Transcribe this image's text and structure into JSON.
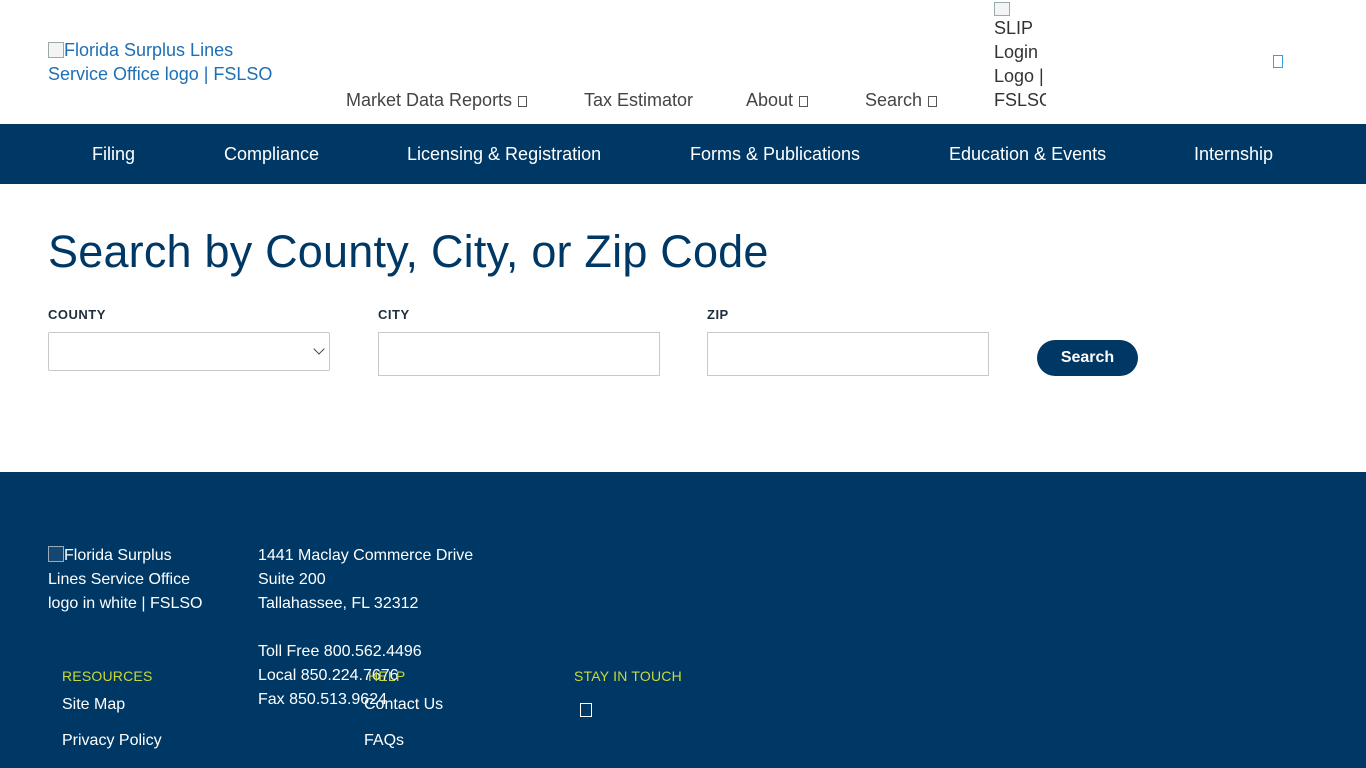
{
  "header": {
    "logo_alt": "Florida Surplus Lines Service Office logo | FSLSO",
    "nav": [
      {
        "label": "Market Data Reports",
        "has_dropdown": true
      },
      {
        "label": "Tax Estimator",
        "has_dropdown": false
      },
      {
        "label": "About",
        "has_dropdown": true
      },
      {
        "label": "Search",
        "has_dropdown": true
      }
    ],
    "slip_logo_alt": "SLIP Login Logo | FSLSO",
    "menu_icon": "menu-icon"
  },
  "main_nav": [
    "Filing",
    "Compliance",
    "Licensing & Registration",
    "Forms & Publications",
    "Education & Events",
    "Internship"
  ],
  "content": {
    "title": "Search by County, City, or Zip Code",
    "county_label": "COUNTY",
    "county_value": "",
    "city_label": "CITY",
    "city_value": "",
    "zip_label": "ZIP",
    "zip_value": "",
    "search_button": "Search"
  },
  "footer": {
    "logo_alt": "Florida Surplus Lines Service Office logo in white | FSLSO",
    "address": {
      "line1": "1441 Maclay Commerce Drive",
      "line2": "Suite 200",
      "line3": "Tallahassee, FL 32312",
      "toll_free": "Toll Free 800.562.4496",
      "local": "Local 850.224.7676",
      "fax": "Fax 850.513.9624"
    },
    "resources_heading": "RESOURCES",
    "resources_links": [
      "Site Map",
      "Privacy Policy"
    ],
    "help_heading": "HELP",
    "help_links": [
      "Contact Us",
      "FAQs"
    ],
    "stay_heading": "STAY IN TOUCH",
    "social_icon": "social-icon"
  },
  "colors": {
    "brand_navy": "#003865",
    "link_blue": "#1f6fb5",
    "accent_yellow": "#c9d83a"
  }
}
